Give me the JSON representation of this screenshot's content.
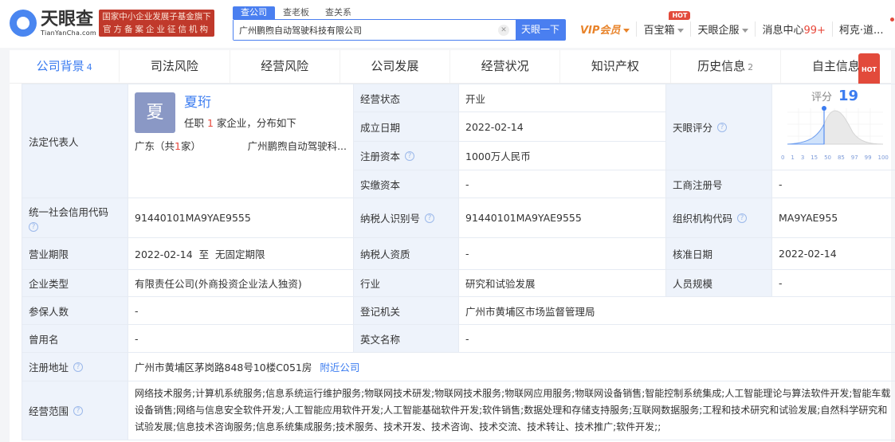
{
  "header": {
    "logo_cn": "天眼查",
    "logo_en": "TianYanCha.com",
    "banner_line1": "国家中小企业发展子基金旗下",
    "banner_line2": "官方备案企业征信机构",
    "search_tabs": [
      "查公司",
      "查老板",
      "查关系"
    ],
    "search_value": "广州鹏煦自动驾驶科技有限公司",
    "search_button": "天眼一下",
    "nav": {
      "vip": "VIP会员",
      "toolbox": "百宝箱",
      "toolbox_badge": "HOT",
      "enterprise": "天眼企服",
      "messages": "消息中心",
      "messages_count": "99+",
      "user": "柯克·道..."
    }
  },
  "tabs": [
    {
      "label": "公司背景",
      "count": "4"
    },
    {
      "label": "司法风险"
    },
    {
      "label": "经营风险"
    },
    {
      "label": "公司发展"
    },
    {
      "label": "经营状况"
    },
    {
      "label": "知识产权"
    },
    {
      "label": "历史信息",
      "count": "2"
    },
    {
      "label": "自主信息",
      "badge": "HOT"
    }
  ],
  "info": {
    "legal_rep_label": "法定代表人",
    "rep": {
      "avatar": "夏",
      "name": "夏珩",
      "desc_pre": "任职 ",
      "count": "1",
      "desc_post": " 家企业，分布如下",
      "loc_pre": "广东（共",
      "loc_count": "1",
      "loc_post": "家）",
      "company": "广州鹏煦自动驾驶科..."
    },
    "status_label": "经营状态",
    "status": "开业",
    "founded_label": "成立日期",
    "founded": "2022-02-14",
    "capital_label": "注册资本",
    "capital": "1000万人民币",
    "paid_label": "实缴资本",
    "paid": "-",
    "score_label": "天眼评分",
    "score_title": "评分",
    "score": "19",
    "score_ticks": [
      "0",
      "1",
      "3",
      "15",
      "50",
      "85",
      "97",
      "99",
      "100"
    ],
    "reg_no_label": "工商注册号",
    "reg_no": "-",
    "credit_code_label": "统一社会信用代码",
    "credit_code": "91440101MA9YAE9555",
    "taxpayer_id_label": "纳税人识别号",
    "taxpayer_id": "91440101MA9YAE9555",
    "org_code_label": "组织机构代码",
    "org_code": "MA9YAE955",
    "term_label": "营业期限",
    "term": "2022-02-14  至  无固定期限",
    "taxpayer_qual_label": "纳税人资质",
    "taxpayer_qual": "-",
    "approved_label": "核准日期",
    "approved": "2022-02-14",
    "type_label": "企业类型",
    "type": "有限责任公司(外商投资企业法人独资)",
    "industry_label": "行业",
    "industry": "研究和试验发展",
    "staff_label": "人员规模",
    "staff": "-",
    "insured_label": "参保人数",
    "insured": "-",
    "authority_label": "登记机关",
    "authority": "广州市黄埔区市场监督管理局",
    "former_label": "曾用名",
    "former": "-",
    "english_label": "英文名称",
    "english": "-",
    "address_label": "注册地址",
    "address": "广州市黄埔区茅岗路848号10楼C051房",
    "nearby": "附近公司",
    "scope_label": "经营范围",
    "scope": "网络技术服务;计算机系统服务;信息系统运行维护服务;物联网技术研发;物联网技术服务;物联网应用服务;物联网设备销售;智能控制系统集成;人工智能理论与算法软件开发;智能车载设备销售;网络与信息安全软件开发;人工智能应用软件开发;人工智能基础软件开发;软件销售;数据处理和存储支持服务;互联网数据服务;工程和技术研究和试验发展;自然科学研究和试验发展;信息技术咨询服务;信息系统集成服务;技术服务、技术开发、技术咨询、技术交流、技术转让、技术推广;软件开发;;"
  },
  "colors": {
    "accent": "#3b7cf0",
    "label_bg": "#eef3fb",
    "hot": "#e24a3b",
    "vip": "#e8832a"
  }
}
